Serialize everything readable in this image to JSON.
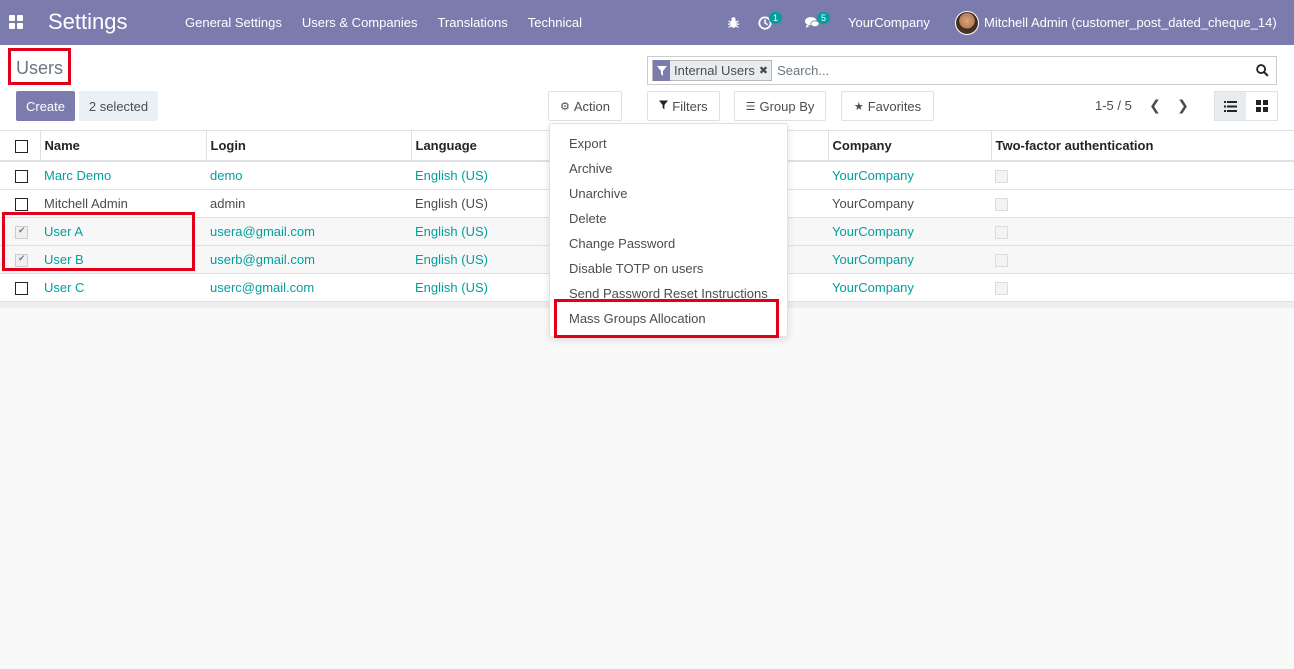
{
  "navbar": {
    "app_title": "Settings",
    "menu": [
      "General Settings",
      "Users & Companies",
      "Translations",
      "Technical"
    ],
    "activity_count": "1",
    "message_count": "5",
    "company": "YourCompany",
    "user": "Mitchell Admin (customer_post_dated_cheque_14)"
  },
  "control_panel": {
    "breadcrumb": "Users",
    "create_label": "Create",
    "selected_label": "2 selected",
    "action_label": "Action",
    "filters_label": "Filters",
    "groupby_label": "Group By",
    "favorites_label": "Favorites",
    "pager": "1-5 / 5"
  },
  "search": {
    "facet_value": "Internal Users",
    "placeholder": "Search..."
  },
  "table": {
    "columns": [
      "Name",
      "Login",
      "Language",
      "",
      "Company",
      "Two-factor authentication"
    ],
    "rows": [
      {
        "name": "Marc Demo",
        "login": "demo",
        "language": "English (US)",
        "company": "YourCompany",
        "selected": false
      },
      {
        "name": "Mitchell Admin",
        "login": "admin",
        "language": "English (US)",
        "company": "YourCompany",
        "selected": false
      },
      {
        "name": "User A",
        "login": "usera@gmail.com",
        "language": "English (US)",
        "company": "YourCompany",
        "selected": true
      },
      {
        "name": "User B",
        "login": "userb@gmail.com",
        "language": "English (US)",
        "company": "YourCompany",
        "selected": true
      },
      {
        "name": "User C",
        "login": "userc@gmail.com",
        "language": "English (US)",
        "company": "YourCompany",
        "selected": false
      }
    ]
  },
  "action_menu": {
    "items": [
      "Export",
      "Archive",
      "Unarchive",
      "Delete",
      "Change Password",
      "Disable TOTP on users",
      "Send Password Reset Instructions",
      "Mass Groups Allocation"
    ]
  },
  "colors": {
    "brand": "#7c7bad",
    "link": "#00a09d",
    "highlight": "#e0001a"
  }
}
